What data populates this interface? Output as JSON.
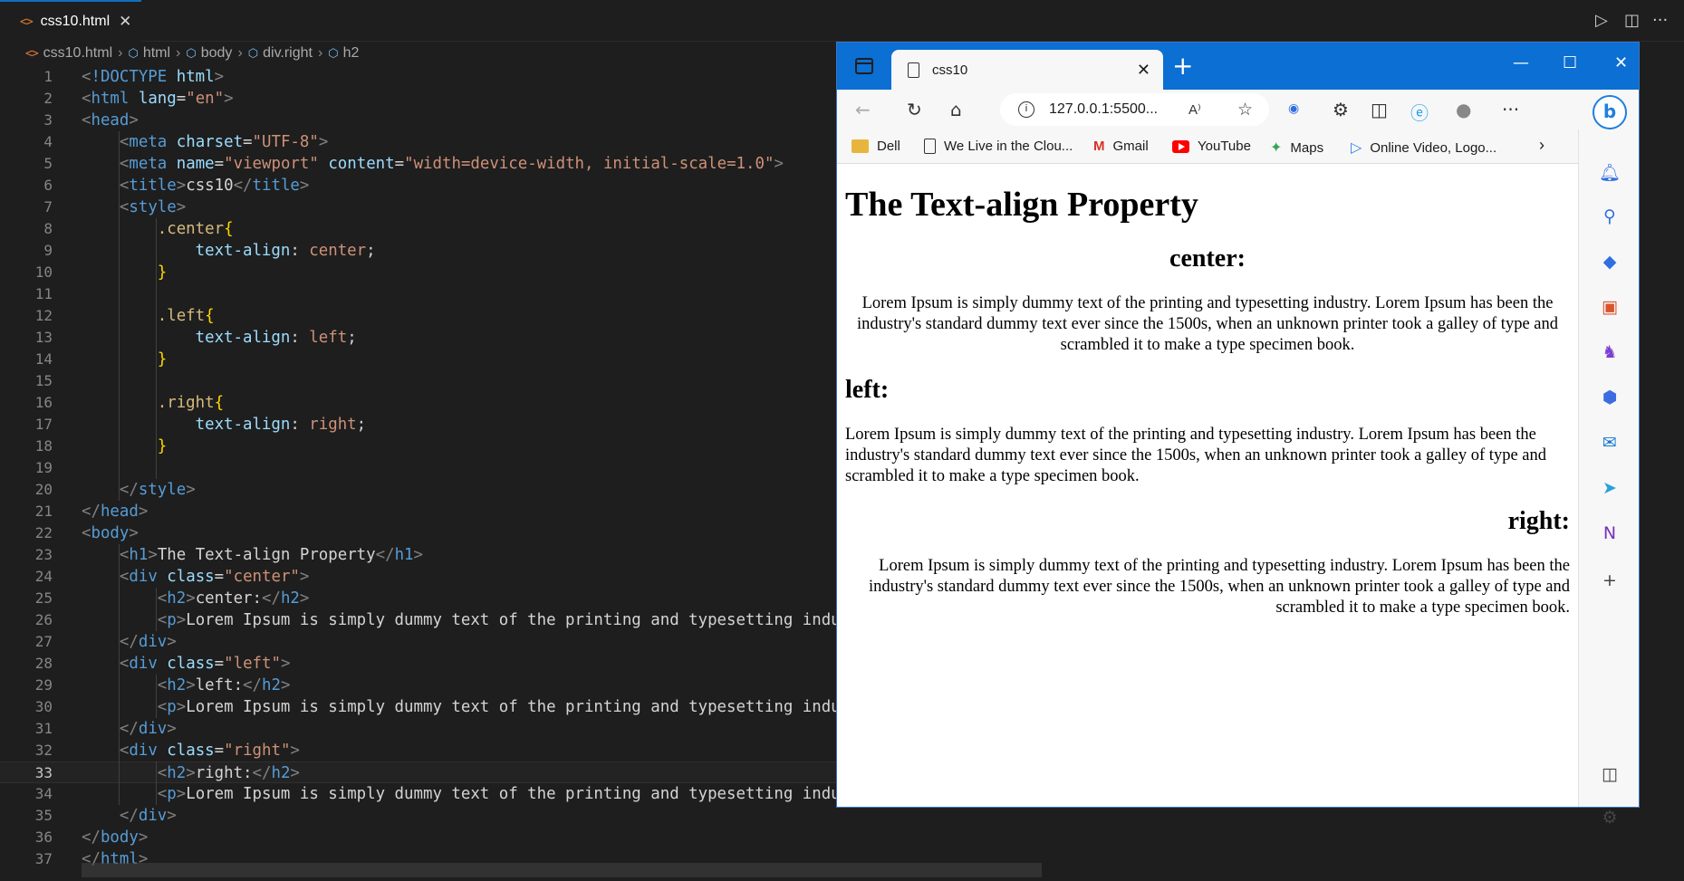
{
  "editor": {
    "tab_label": "css10.html",
    "breadcrumb": [
      "css10.html",
      "html",
      "body",
      "div.right",
      "h2"
    ],
    "current_line": 33,
    "lines": [
      {
        "n": "1",
        "html": "<span class='g'>&lt;</span><span class='t'>!DOCTYPE</span> <span class='a'>html</span><span class='g'>&gt;</span>"
      },
      {
        "n": "2",
        "html": "<span class='g'>&lt;</span><span class='t'>html</span> <span class='a'>lang</span><span class='x'>=</span><span class='s'>\"en\"</span><span class='g'>&gt;</span>"
      },
      {
        "n": "3",
        "html": "<span class='g'>&lt;</span><span class='t'>head</span><span class='g'>&gt;</span>"
      },
      {
        "n": "4",
        "html": "    <span class='g'>&lt;</span><span class='t'>meta</span> <span class='a'>charset</span><span class='x'>=</span><span class='s'>\"UTF-8\"</span><span class='g'>&gt;</span>"
      },
      {
        "n": "5",
        "html": "    <span class='g'>&lt;</span><span class='t'>meta</span> <span class='a'>name</span><span class='x'>=</span><span class='s'>\"viewport\"</span> <span class='a'>content</span><span class='x'>=</span><span class='s'>\"width=device-width, initial-scale=1.0\"</span><span class='g'>&gt;</span>"
      },
      {
        "n": "6",
        "html": "    <span class='g'>&lt;</span><span class='t'>title</span><span class='g'>&gt;</span><span class='x'>css10</span><span class='g'>&lt;/</span><span class='t'>title</span><span class='g'>&gt;</span>"
      },
      {
        "n": "7",
        "html": "    <span class='g'>&lt;</span><span class='t'>style</span><span class='g'>&gt;</span>"
      },
      {
        "n": "8",
        "html": "        <span class='sel'>.center</span><span class='br'>{</span>"
      },
      {
        "n": "9",
        "html": "            <span class='a'>text-align</span><span class='x'>: </span><span class='s'>center</span><span class='x'>;</span>"
      },
      {
        "n": "10",
        "html": "        <span class='br'>}</span>"
      },
      {
        "n": "11",
        "html": ""
      },
      {
        "n": "12",
        "html": "        <span class='sel'>.left</span><span class='br'>{</span>"
      },
      {
        "n": "13",
        "html": "            <span class='a'>text-align</span><span class='x'>: </span><span class='s'>left</span><span class='x'>;</span>"
      },
      {
        "n": "14",
        "html": "        <span class='br'>}</span>"
      },
      {
        "n": "15",
        "html": ""
      },
      {
        "n": "16",
        "html": "        <span class='sel'>.right</span><span class='br'>{</span>"
      },
      {
        "n": "17",
        "html": "            <span class='a'>text-align</span><span class='x'>: </span><span class='s'>right</span><span class='x'>;</span>"
      },
      {
        "n": "18",
        "html": "        <span class='br'>}</span>"
      },
      {
        "n": "19",
        "html": ""
      },
      {
        "n": "20",
        "html": "    <span class='g'>&lt;/</span><span class='t'>style</span><span class='g'>&gt;</span>"
      },
      {
        "n": "21",
        "html": "<span class='g'>&lt;/</span><span class='t'>head</span><span class='g'>&gt;</span>"
      },
      {
        "n": "22",
        "html": "<span class='g'>&lt;</span><span class='t'>body</span><span class='g'>&gt;</span>"
      },
      {
        "n": "23",
        "html": "    <span class='g'>&lt;</span><span class='t'>h1</span><span class='g'>&gt;</span><span class='x'>The Text-align Property</span><span class='g'>&lt;/</span><span class='t'>h1</span><span class='g'>&gt;</span>"
      },
      {
        "n": "24",
        "html": "    <span class='g'>&lt;</span><span class='t'>div</span> <span class='a'>class</span><span class='x'>=</span><span class='s'>\"center\"</span><span class='g'>&gt;</span>"
      },
      {
        "n": "25",
        "html": "        <span class='g'>&lt;</span><span class='t'>h2</span><span class='g'>&gt;</span><span class='x'>center:</span><span class='g'>&lt;/</span><span class='t'>h2</span><span class='g'>&gt;</span>"
      },
      {
        "n": "26",
        "html": "        <span class='g'>&lt;</span><span class='t'>p</span><span class='g'>&gt;</span><span class='x'>Lorem Ipsum is simply dummy text of the printing and typesetting industry. L</span>"
      },
      {
        "n": "27",
        "html": "    <span class='g'>&lt;/</span><span class='t'>div</span><span class='g'>&gt;</span>"
      },
      {
        "n": "28",
        "html": "    <span class='g'>&lt;</span><span class='t'>div</span> <span class='a'>class</span><span class='x'>=</span><span class='s'>\"left\"</span><span class='g'>&gt;</span>"
      },
      {
        "n": "29",
        "html": "        <span class='g'>&lt;</span><span class='t'>h2</span><span class='g'>&gt;</span><span class='x'>left:</span><span class='g'>&lt;/</span><span class='t'>h2</span><span class='g'>&gt;</span>"
      },
      {
        "n": "30",
        "html": "        <span class='g'>&lt;</span><span class='t'>p</span><span class='g'>&gt;</span><span class='x'>Lorem Ipsum is simply dummy text of the printing and typesetting industry. L</span>"
      },
      {
        "n": "31",
        "html": "    <span class='g'>&lt;/</span><span class='t'>div</span><span class='g'>&gt;</span>"
      },
      {
        "n": "32",
        "html": "    <span class='g'>&lt;</span><span class='t'>div</span> <span class='a'>class</span><span class='x'>=</span><span class='s'>\"right\"</span><span class='g'>&gt;</span>"
      },
      {
        "n": "33",
        "html": "        <span class='g'>&lt;</span><span class='t'>h2</span><span class='g'>&gt;</span><span class='x'>right:</span><span class='g'>&lt;/</span><span class='t'>h2</span><span class='g'>&gt;</span>"
      },
      {
        "n": "34",
        "html": "        <span class='g'>&lt;</span><span class='t'>p</span><span class='g'>&gt;</span><span class='x'>Lorem Ipsum is simply dummy text of the printing and typesetting industry. L</span>"
      },
      {
        "n": "35",
        "html": "    <span class='g'>&lt;/</span><span class='t'>div</span><span class='g'>&gt;</span>"
      },
      {
        "n": "36",
        "html": "<span class='g'>&lt;/</span><span class='t'>body</span><span class='g'>&gt;</span>"
      },
      {
        "n": "37",
        "html": "<span class='g'>&lt;/</span><span class='t'>html</span><span class='g'>&gt;</span>"
      }
    ]
  },
  "browser": {
    "tab_title": "css10",
    "url": "127.0.0.1:5500...",
    "favorites": [
      "Dell",
      "We Live in the Clou...",
      "Gmail",
      "YouTube",
      "Maps",
      "Online Video, Logo..."
    ],
    "page": {
      "h1": "The Text-align Property",
      "center_heading": "center:",
      "left_heading": "left:",
      "right_heading": "right:",
      "paragraph": "Lorem Ipsum is simply dummy text of the printing and typesetting industry. Lorem Ipsum has been the industry's standard dummy text ever since the 1500s, when an unknown printer took a galley of type and scrambled it to make a type specimen book."
    },
    "accent_color": "#0b6fd3"
  }
}
